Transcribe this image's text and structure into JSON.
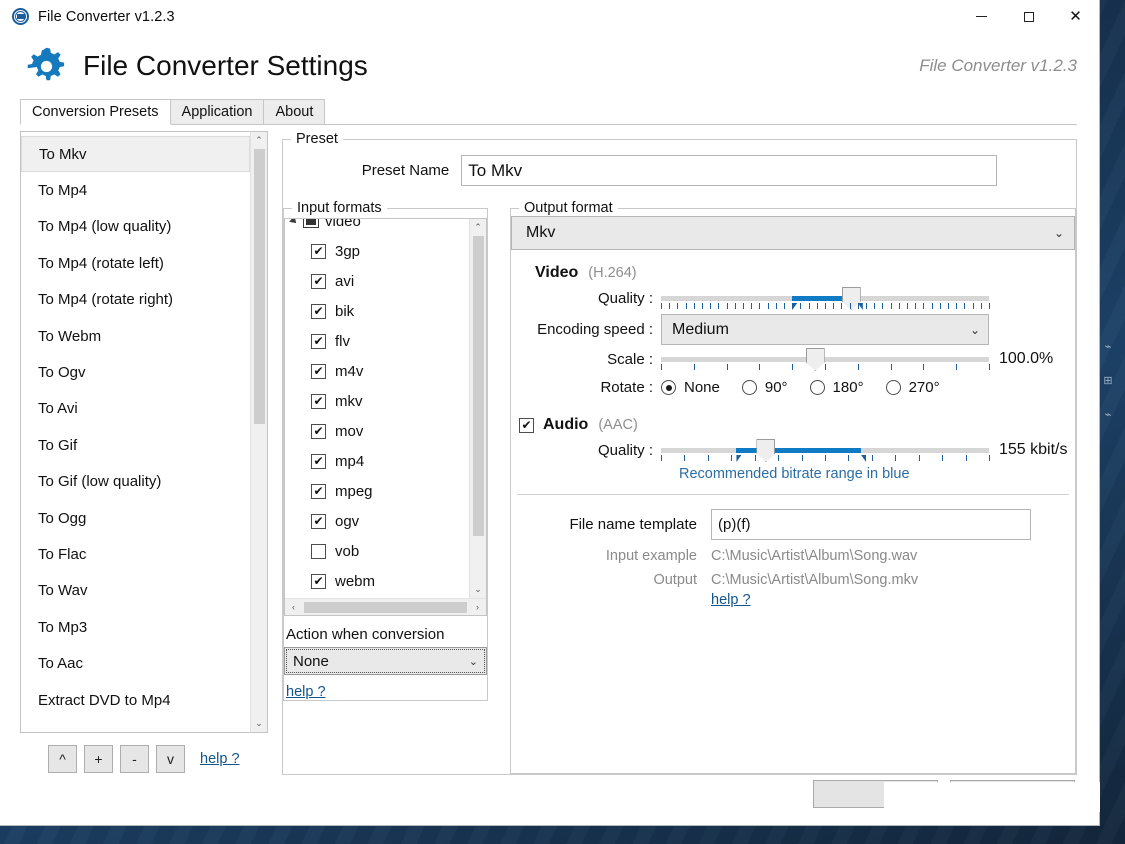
{
  "window": {
    "title": "File Converter v1.2.3",
    "icon": "app-logo-icon",
    "minimize": "—",
    "maximize": "□",
    "close": "✕"
  },
  "header": {
    "icon": "gear-icon",
    "title": "File Converter Settings",
    "version": "File Converter v1.2.3"
  },
  "tabs": [
    {
      "label": "Conversion Presets",
      "active": true
    },
    {
      "label": "Application",
      "active": false
    },
    {
      "label": "About",
      "active": false
    }
  ],
  "preset_list": {
    "items": [
      "To Mkv",
      "To Mp4",
      "To Mp4 (low quality)",
      "To Mp4 (rotate left)",
      "To Mp4 (rotate right)",
      "To Webm",
      "To Ogv",
      "To Avi",
      "To Gif",
      "To Gif (low quality)",
      "To Ogg",
      "To Flac",
      "To Wav",
      "To Mp3",
      "To Aac",
      "Extract DVD to Mp4"
    ],
    "selected": "To Mkv",
    "scroll_up": "⌃",
    "scroll_down": "⌄"
  },
  "preset_buttons": {
    "move_up": "^",
    "add": "+",
    "remove": "-",
    "move_down": "v",
    "help": "help ?"
  },
  "preset_group": {
    "legend": "Preset",
    "name_label": "Preset Name",
    "name_value": "To Mkv"
  },
  "input_formats": {
    "legend": "Input formats",
    "root": "video",
    "items": [
      {
        "label": "3gp",
        "checked": true
      },
      {
        "label": "avi",
        "checked": true
      },
      {
        "label": "bik",
        "checked": true
      },
      {
        "label": "flv",
        "checked": true
      },
      {
        "label": "m4v",
        "checked": true
      },
      {
        "label": "mkv",
        "checked": true
      },
      {
        "label": "mov",
        "checked": true
      },
      {
        "label": "mp4",
        "checked": true
      },
      {
        "label": "mpeg",
        "checked": true
      },
      {
        "label": "ogv",
        "checked": true
      },
      {
        "label": "vob",
        "checked": false
      },
      {
        "label": "webm",
        "checked": true
      }
    ],
    "checkmark": "✔",
    "action_label": "Action when conversion",
    "action_value": "None",
    "help": "help ?",
    "scroll_left": "‹",
    "scroll_right": "›",
    "scroll_up": "⌃",
    "scroll_down": "⌄"
  },
  "output_format": {
    "legend": "Output format",
    "format_value": "Mkv",
    "chevron": "⌄",
    "video": {
      "title": "Video",
      "codec": "(H.264)",
      "quality_label": "Quality :",
      "quality_thumb_pct": 58,
      "quality_fill_start_pct": 40,
      "quality_fill_end_pct": 60,
      "encoding_label": "Encoding speed :",
      "encoding_value": "Medium",
      "scale_label": "Scale :",
      "scale_value": "100.0%",
      "scale_thumb_pct": 47,
      "rotate_label": "Rotate :",
      "rotate_options": [
        {
          "label": "None",
          "selected": true
        },
        {
          "label": "90°",
          "selected": false
        },
        {
          "label": "180°",
          "selected": false
        },
        {
          "label": "270°",
          "selected": false
        }
      ]
    },
    "audio": {
      "title": "Audio",
      "codec": "(AAC)",
      "checked": true,
      "quality_label": "Quality :",
      "quality_value": "155 kbit/s",
      "quality_thumb_pct": 32,
      "quality_fill_start_pct": 23,
      "quality_fill_end_pct": 61,
      "hint": "Recommended bitrate range in blue"
    },
    "file_template": {
      "label": "File name template",
      "value": "(p)(f)",
      "input_example_label": "Input example",
      "input_example_value": "C:\\Music\\Artist\\Album\\Song.wav",
      "output_label": "Output",
      "output_value": "C:\\Music\\Artist\\Album\\Song.mkv",
      "help": "help ?"
    }
  },
  "colors": {
    "accent_blue": "#0f7bc4",
    "link_blue": "#12558c",
    "tick_blue": "#1d5f9e",
    "muted_gray": "#8a8a8a"
  }
}
